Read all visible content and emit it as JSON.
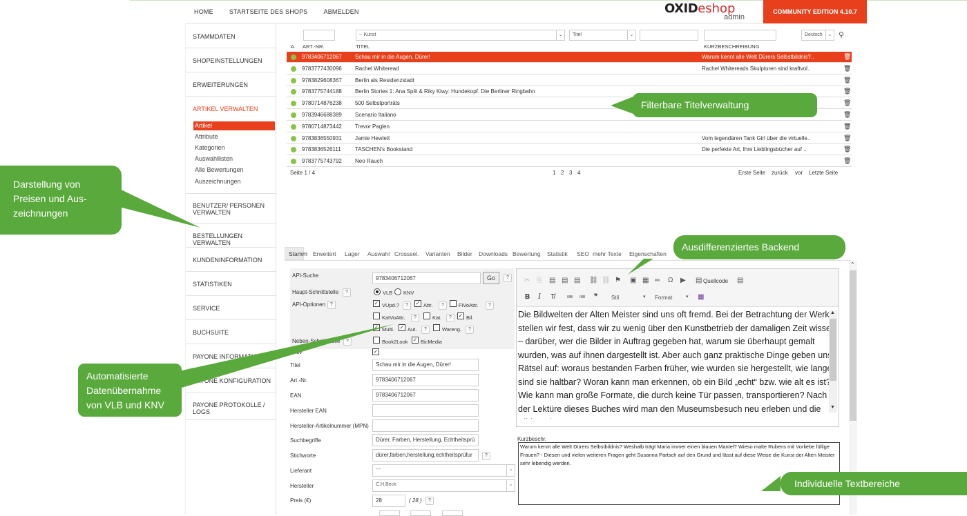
{
  "topnav": {
    "home": "HOME",
    "shop_start": "STARTSEITE DES SHOPS",
    "logout": "ABMELDEN"
  },
  "logo": {
    "oxid": "OXID",
    "eshop": "eshop",
    "admin": "admin"
  },
  "edition": "COMMUNITY EDITION 4.10.7",
  "sidebar": {
    "items": [
      "STAMMDATEN",
      "SHOPEINSTELLUNGEN",
      "ERWEITERUNGEN",
      "ARTIKEL VERWALTEN",
      "BENUTZER/ PERSONEN VERWALTEN",
      "BESTELLUNGEN VERWALTEN",
      "KUNDENINFORMATION",
      "STATISTIKEN",
      "SERVICE",
      "BUCHSUITE",
      "PAYONE INFORMATION",
      "PAYONE KONFIGURATION",
      "PAYONE PROTOKOLLE / LOGS"
    ],
    "subitems": [
      "Artikel",
      "Attribute",
      "Kategorien",
      "Auswahllisten",
      "Alle Bewertungen",
      "Auszeichnungen"
    ]
  },
  "filter": {
    "category": "-- Kunst",
    "field": "Titel",
    "language": "Deutsch"
  },
  "columns": {
    "a": "A",
    "artnr": "ART.-NR.",
    "title": "TITEL",
    "short": "KURZBESCHREIBUNG"
  },
  "rows": [
    {
      "nr": "9783406712067",
      "title": "Schau mir in die Augen, Dürer!",
      "short": "Warum kennt alle Welt Dürers Selbstbildnis?.."
    },
    {
      "nr": "9783777430096",
      "title": "Rachel Whiteread",
      "short": "Rachel Whitereads Skulpturen sind kraftvol.."
    },
    {
      "nr": "9783829608367",
      "title": "Berlin als Residenzstadt",
      "short": ""
    },
    {
      "nr": "9783775744188",
      "title": "Berlin Stories 1: Ana Split & Riky Kiwy: Hundekopf. Die Berliner Ringbahn",
      "short": ""
    },
    {
      "nr": "9780714876238",
      "title": "500 Selbstporträts",
      "short": ""
    },
    {
      "nr": "9783946688389",
      "title": "Scenario Italiano",
      "short": ""
    },
    {
      "nr": "9780714873442",
      "title": "Trevor Paglen",
      "short": ""
    },
    {
      "nr": "9783836550931",
      "title": "Jamie Hewlett",
      "short": "Vom legendären Tank Girl über die virtuelle.."
    },
    {
      "nr": "9783836526111",
      "title": "TASCHEN's Bookstand",
      "short": "Die perfekte Art, Ihre Lieblingsbücher auf .."
    },
    {
      "nr": "9783775743792",
      "title": "Neo Rauch",
      "short": ""
    }
  ],
  "pagination": {
    "page": "Seite 1 / 4",
    "p1": "1",
    "p2": "2",
    "p3": "3",
    "p4": "4",
    "first": "Erste Seite",
    "back": "zurück",
    "fwd": "vor",
    "last": "Letzte Seite"
  },
  "tabs": [
    "Stamm",
    "Erweitert",
    "Lager",
    "Auswahl",
    "Crosssel.",
    "Varianten",
    "Bilder",
    "Downloads",
    "Bewertung",
    "Statistik",
    "SEO",
    "mehr Texte",
    "Eigenschaften"
  ],
  "form": {
    "api_search_label": "API-Suche",
    "api_search_value": "9783406712067",
    "go": "Go",
    "main_if_label": "Haupt-Schnittstelle",
    "vlb": "VLB",
    "knv": "KNV",
    "api_opt_label": "API-Optionen",
    "opt_vupd": "VUpd.?",
    "opt_attr": "Attr.",
    "opt_fivo": "FiVoAttr.",
    "opt_katvo": "KatVoAttr.",
    "opt_kat": "Kat.",
    "opt_bil": "Bil.",
    "opt_multi": "Multi.",
    "opt_aut": "Aut.",
    "opt_wareng": "Wareng.",
    "side_if_label": "Neben-Schnittstelle",
    "book2look": "Book2Look",
    "bicmedia": "BicMedia",
    "aktiv": "Aktiv",
    "titel_label": "Titel",
    "titel_value": "Schau mir in die Augen, Dürer!",
    "artnr_label": "Art.-Nr.",
    "artnr_value": "9783406712067",
    "ean_label": "EAN",
    "ean_value": "9783406712067",
    "heran_label": "Hersteller EAN",
    "herartnr_label": "Hersteller-Artikelnummer (MPN)",
    "such_label": "Suchbegriffe",
    "such_value": "Dürer, Farben, Herstellung, Echtheitsprü",
    "stich_label": "Stichworte",
    "stich_value": "dürer,farben,herstellung,echtheitsprüfur",
    "lief_label": "Lieferant",
    "lief_value": "---",
    "hers_label": "Hersteller",
    "hers_value": "C.H.Beck",
    "preis_label": "Preis (€)",
    "preis_value": "28",
    "preis_brutto": "( 28 )"
  },
  "editor": {
    "quellcode": "Quellcode",
    "stil": "Stil",
    "format": "Format",
    "text": "Die Bildwelten der Alten Meister sind uns oft fremd. Bei der Betrachtung der Werke stellen wir fest, dass wir zu wenig über den Kunstbetrieb der damaligen Zeit wissen – darüber, wer die Bilder in Auftrag gegeben hat, warum sie überhaupt gemalt wurden, was auf ihnen dargestellt ist. Aber auch ganz praktische Dinge geben uns Rätsel auf: woraus bestanden Farben früher, wie wurden sie hergestellt, wie lange sind sie haltbar? Woran kann man erkennen, ob ein Bild „echt“ bzw. wie alt es ist? Wie kann man große Formate, die durch keine Tür passen, transportieren? Nach der Lektüre dieses Buches wird man den Museumsbesuch neu erleben und die Bilder mit",
    "kurz_label": "Kurzbeschr.",
    "kurz_text": "Warum kennt alle Welt Dürers Selbstbildnis? Weshalb trägt Maria immer einen blauen Mantel? Wieso malte Rubens mit Vorliebe füllige Frauen? - Diesen und vielen weiteren Fragen geht Susanna Partsch auf den Grund und lässt auf diese Weise die Kunst der Alten Meister sehr lebendig werden."
  },
  "callouts": {
    "titel": "Filterbare Titelverwaltung",
    "backend": "Ausdifferenziertes  Backend",
    "preise": "Darstellung von Preisen und Aus-zeichnungen",
    "auto": "Automatisierte Datenübernahme von VLB und KNV",
    "text": "Individuelle Textbereiche"
  },
  "colors": {
    "accent": "#e8401c",
    "callout": "#5aa93c",
    "active_dot": "#8bc34a"
  }
}
